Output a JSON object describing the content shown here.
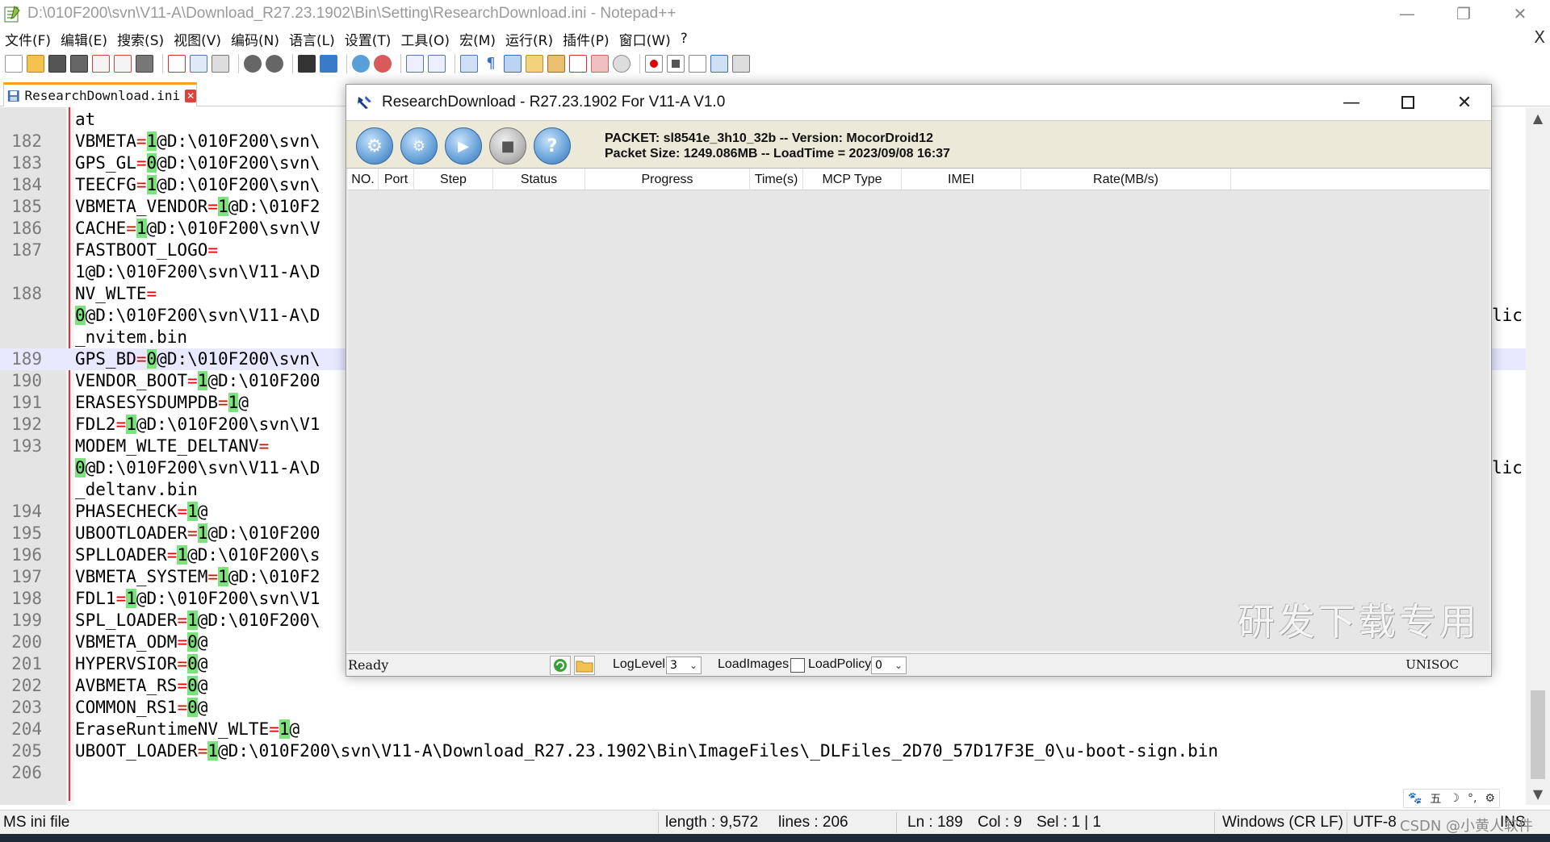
{
  "window": {
    "title": "D:\\010F200\\svn\\V11-A\\Download_R27.23.1902\\Bin\\Setting\\ResearchDownload.ini - Notepad++",
    "minimize_icon": "—",
    "restore_icon": "❐",
    "close_icon": "✕"
  },
  "menu": [
    "文件(F)",
    "编辑(E)",
    "搜索(S)",
    "视图(V)",
    "编码(N)",
    "语言(L)",
    "设置(T)",
    "工具(O)",
    "宏(M)",
    "运行(R)",
    "插件(P)",
    "窗口(W)",
    "?"
  ],
  "menu_close": "X",
  "tab": {
    "label": "ResearchDownload.ini",
    "close": "✕"
  },
  "editor": {
    "first_line_text": "at",
    "lines": [
      {
        "n": "182",
        "key": "VBMETA",
        "val": "1",
        "rest": "@D:\\010F200\\svn\\",
        "tail": ""
      },
      {
        "n": "183",
        "key": "GPS_GL",
        "val": "0",
        "rest": "@D:\\010F200\\svn\\",
        "tail": ""
      },
      {
        "n": "184",
        "key": "TEECFG",
        "val": "1",
        "rest": "@D:\\010F200\\svn\\",
        "tail": ""
      },
      {
        "n": "185",
        "key": "VBMETA_VENDOR",
        "val": "1",
        "rest": "@D:\\010F2",
        "tail": ""
      },
      {
        "n": "186",
        "key": "CACHE",
        "val": "1",
        "rest": "@D:\\010F200\\svn\\V",
        "tail": ""
      },
      {
        "n": "187",
        "key": "FASTBOOT_LOGO",
        "val": "",
        "rest": "",
        "tail": ""
      },
      {
        "n": "",
        "key": "",
        "val": "",
        "rest": "1@D:\\010F200\\svn\\V11-A\\D",
        "tail": ""
      },
      {
        "n": "188",
        "key": "NV_WLTE",
        "val": "",
        "rest": "",
        "tail": ""
      },
      {
        "n": "",
        "key": "",
        "val": "0",
        "rest": "@D:\\010F200\\svn\\V11-A\\D",
        "tail": "lic"
      },
      {
        "n": "",
        "key": "",
        "val": "",
        "rest": "_nvitem.bin",
        "tail": ""
      },
      {
        "n": "189",
        "key": "GPS_BD",
        "val": "0",
        "rest": "@D:\\010F200\\svn\\",
        "tail": "",
        "hl": true
      },
      {
        "n": "190",
        "key": "VENDOR_BOOT",
        "val": "1",
        "rest": "@D:\\010F200",
        "tail": ""
      },
      {
        "n": "191",
        "key": "ERASESYSDUMPDB",
        "val": "1",
        "rest": "@",
        "tail": ""
      },
      {
        "n": "192",
        "key": "FDL2",
        "val": "1",
        "rest": "@D:\\010F200\\svn\\V1",
        "tail": ""
      },
      {
        "n": "193",
        "key": "MODEM_WLTE_DELTANV",
        "val": "",
        "rest": "",
        "tail": ""
      },
      {
        "n": "",
        "key": "",
        "val": "0",
        "rest": "@D:\\010F200\\svn\\V11-A\\D",
        "tail": "lic"
      },
      {
        "n": "",
        "key": "",
        "val": "",
        "rest": "_deltanv.bin",
        "tail": ""
      },
      {
        "n": "194",
        "key": "PHASECHECK",
        "val": "1",
        "rest": "@",
        "tail": ""
      },
      {
        "n": "195",
        "key": "UBOOTLOADER",
        "val": "1",
        "rest": "@D:\\010F200",
        "tail": ""
      },
      {
        "n": "196",
        "key": "SPLLOADER",
        "val": "1",
        "rest": "@D:\\010F200\\s",
        "tail": ""
      },
      {
        "n": "197",
        "key": "VBMETA_SYSTEM",
        "val": "1",
        "rest": "@D:\\010F2",
        "tail": ""
      },
      {
        "n": "198",
        "key": "FDL1",
        "val": "1",
        "rest": "@D:\\010F200\\svn\\V1",
        "tail": ""
      },
      {
        "n": "199",
        "key": "SPL_LOADER",
        "val": "1",
        "rest": "@D:\\010F200\\",
        "tail": ""
      },
      {
        "n": "200",
        "key": "VBMETA_ODM",
        "val": "0",
        "rest": "@",
        "tail": ""
      },
      {
        "n": "201",
        "key": "HYPERVSIOR",
        "val": "0",
        "rest": "@",
        "tail": ""
      },
      {
        "n": "202",
        "key": "AVBMETA_RS",
        "val": "0",
        "rest": "@",
        "tail": ""
      },
      {
        "n": "203",
        "key": "COMMON_RS1",
        "val": "0",
        "rest": "@",
        "tail": ""
      },
      {
        "n": "204",
        "key": "EraseRuntimeNV_WLTE",
        "val": "1",
        "rest": "@",
        "tail": ""
      },
      {
        "n": "205",
        "key": "UBOOT_LOADER",
        "val": "1",
        "rest": "@D:\\010F200\\svn\\V11-A\\Download_R27.23.1902\\Bin\\ImageFiles\\_DLFiles_2D70_57D17F3E_0\\u-boot-sign.bin",
        "tail": ""
      },
      {
        "n": "206",
        "key": "",
        "val": "",
        "rest": "",
        "tail": ""
      }
    ]
  },
  "status": {
    "filetype": "MS ini file",
    "length": "length : 9,572",
    "lines": "lines : 206",
    "ln": "Ln : 189",
    "col": "Col : 9",
    "sel": "Sel : 1 | 1",
    "eol": "Windows (CR LF)",
    "encoding": "UTF-8",
    "mode": "INS"
  },
  "ime_bar": [
    "🐾",
    "五",
    "☽",
    "°,",
    "⚙"
  ],
  "watermark_csdn": "CSDN @小黄人软件",
  "dialog": {
    "title": "ResearchDownload - R27.23.1902 For V11-A V1.0",
    "packet_line1": "PACKET: sl8541e_3h10_32b  --  Version: MocorDroid12",
    "packet_line2": "Packet Size: 1249.086MB  --  LoadTime = 2023/09/08 16:37",
    "toolbar_icons": [
      "gear-icon",
      "settings-gears-icon",
      "play-icon",
      "stop-icon",
      "help-icon"
    ],
    "toolbar_glyphs": [
      "⚙",
      "⚙",
      "▶",
      "■",
      "?"
    ],
    "columns": [
      "NO.",
      "Port",
      "Step",
      "Status",
      "Progress",
      "Time(s)",
      "MCP Type",
      "IMEI",
      "Rate(MB/s)"
    ],
    "watermark": "研发下载专用",
    "status_text": "Ready",
    "loglevel_label": "LogLevel :",
    "loglevel_value": "3",
    "loadimages_label": "LoadImages :",
    "loadpolicy_label": "LoadPolicy :",
    "loadpolicy_value": "0",
    "brand": "UNISOC",
    "dropdown_arrow": "⌄"
  },
  "colors": {
    "accent_tab": "#f5a020",
    "operator": "#e00000",
    "value_highlight": "#7be37b",
    "current_line": "#e8e8ff"
  }
}
